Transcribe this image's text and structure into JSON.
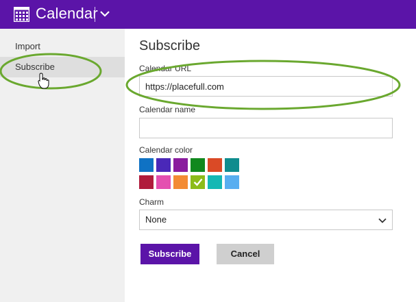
{
  "app": {
    "title": "Calendar",
    "icon": "calendar-grid-icon",
    "menu_icon": "chevron-down-icon",
    "header_color": "#5b14a8"
  },
  "sidebar": {
    "items": [
      {
        "label": "Import",
        "selected": false
      },
      {
        "label": "Subscribe",
        "selected": true
      }
    ]
  },
  "form": {
    "title": "Subscribe",
    "url_label": "Calendar URL",
    "url_value": "https://placefull.com",
    "name_label": "Calendar name",
    "name_value": "",
    "color_label": "Calendar color",
    "colors": [
      "#0f72c4",
      "#4a28b8",
      "#8a1c9e",
      "#11881e",
      "#da4a26",
      "#0f8c8e",
      "#b01c3c",
      "#e44fb0",
      "#f38b34",
      "#8cbc1a",
      "#14b8b4",
      "#58aef0"
    ],
    "selected_color": "#8cbc1a",
    "charm_label": "Charm",
    "charm_value": "None",
    "subscribe_button": "Subscribe",
    "cancel_button": "Cancel"
  },
  "annotations": {
    "highlight_color": "#6aa82f"
  }
}
